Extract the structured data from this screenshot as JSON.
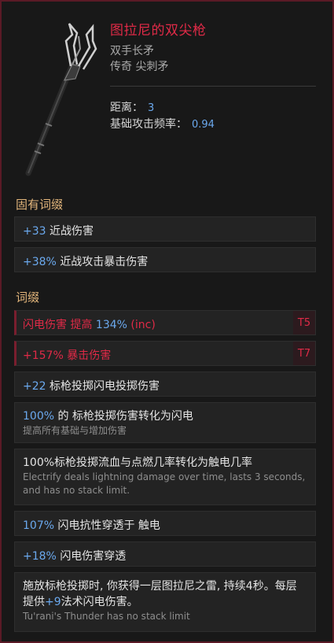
{
  "item": {
    "name": "图拉尼的双尖枪",
    "type": "双手长矛",
    "rarity": "传奇 尖刺矛",
    "stats": [
      {
        "label": "距离：",
        "value": "3"
      },
      {
        "label": "基础攻击频率：",
        "value": "0.94"
      }
    ]
  },
  "implicit": {
    "title": "固有词缀",
    "rows": [
      {
        "value": "+33",
        "text": "近战伤害"
      },
      {
        "value": "+38%",
        "text": "近战攻击暴击伤害"
      }
    ]
  },
  "affixes": {
    "title": "词缀",
    "rows": [
      {
        "text": "闪电伤害 提高",
        "value": "134%",
        "suffix": "(inc)",
        "tier": "T5"
      },
      {
        "value": "+157%",
        "text": "暴击伤害",
        "tier": "T7"
      },
      {
        "value": "+22",
        "text": "标枪投掷闪电投掷伤害"
      },
      {
        "value": "100%",
        "text": "的 标枪投掷伤害转化为闪电",
        "note": "提高所有基础与增加伤害"
      },
      {
        "text": "100%标枪投掷流血与点燃几率转化为触电几率",
        "note": "Electrify deals lightning damage over time, lasts 3 seconds, and has no stack limit."
      },
      {
        "value": "107%",
        "text": "闪电抗性穿透于 触电"
      },
      {
        "value": "+18%",
        "text": "闪电伤害穿透"
      },
      {
        "text_a": "施放标枪投掷时, 你获得一层图拉尼之雷, 持续4秒。每层提供",
        "value": "+9",
        "text_b": "法术闪电伤害。",
        "note": "Tu'rani's Thunder has no stack limit"
      }
    ]
  },
  "colors": {
    "name": "#e02a47",
    "value": "#6ba9ee",
    "section": "#e2b57b",
    "border": "#5a1a26"
  },
  "icons": {
    "weapon": "double-tipped-spear-icon"
  }
}
